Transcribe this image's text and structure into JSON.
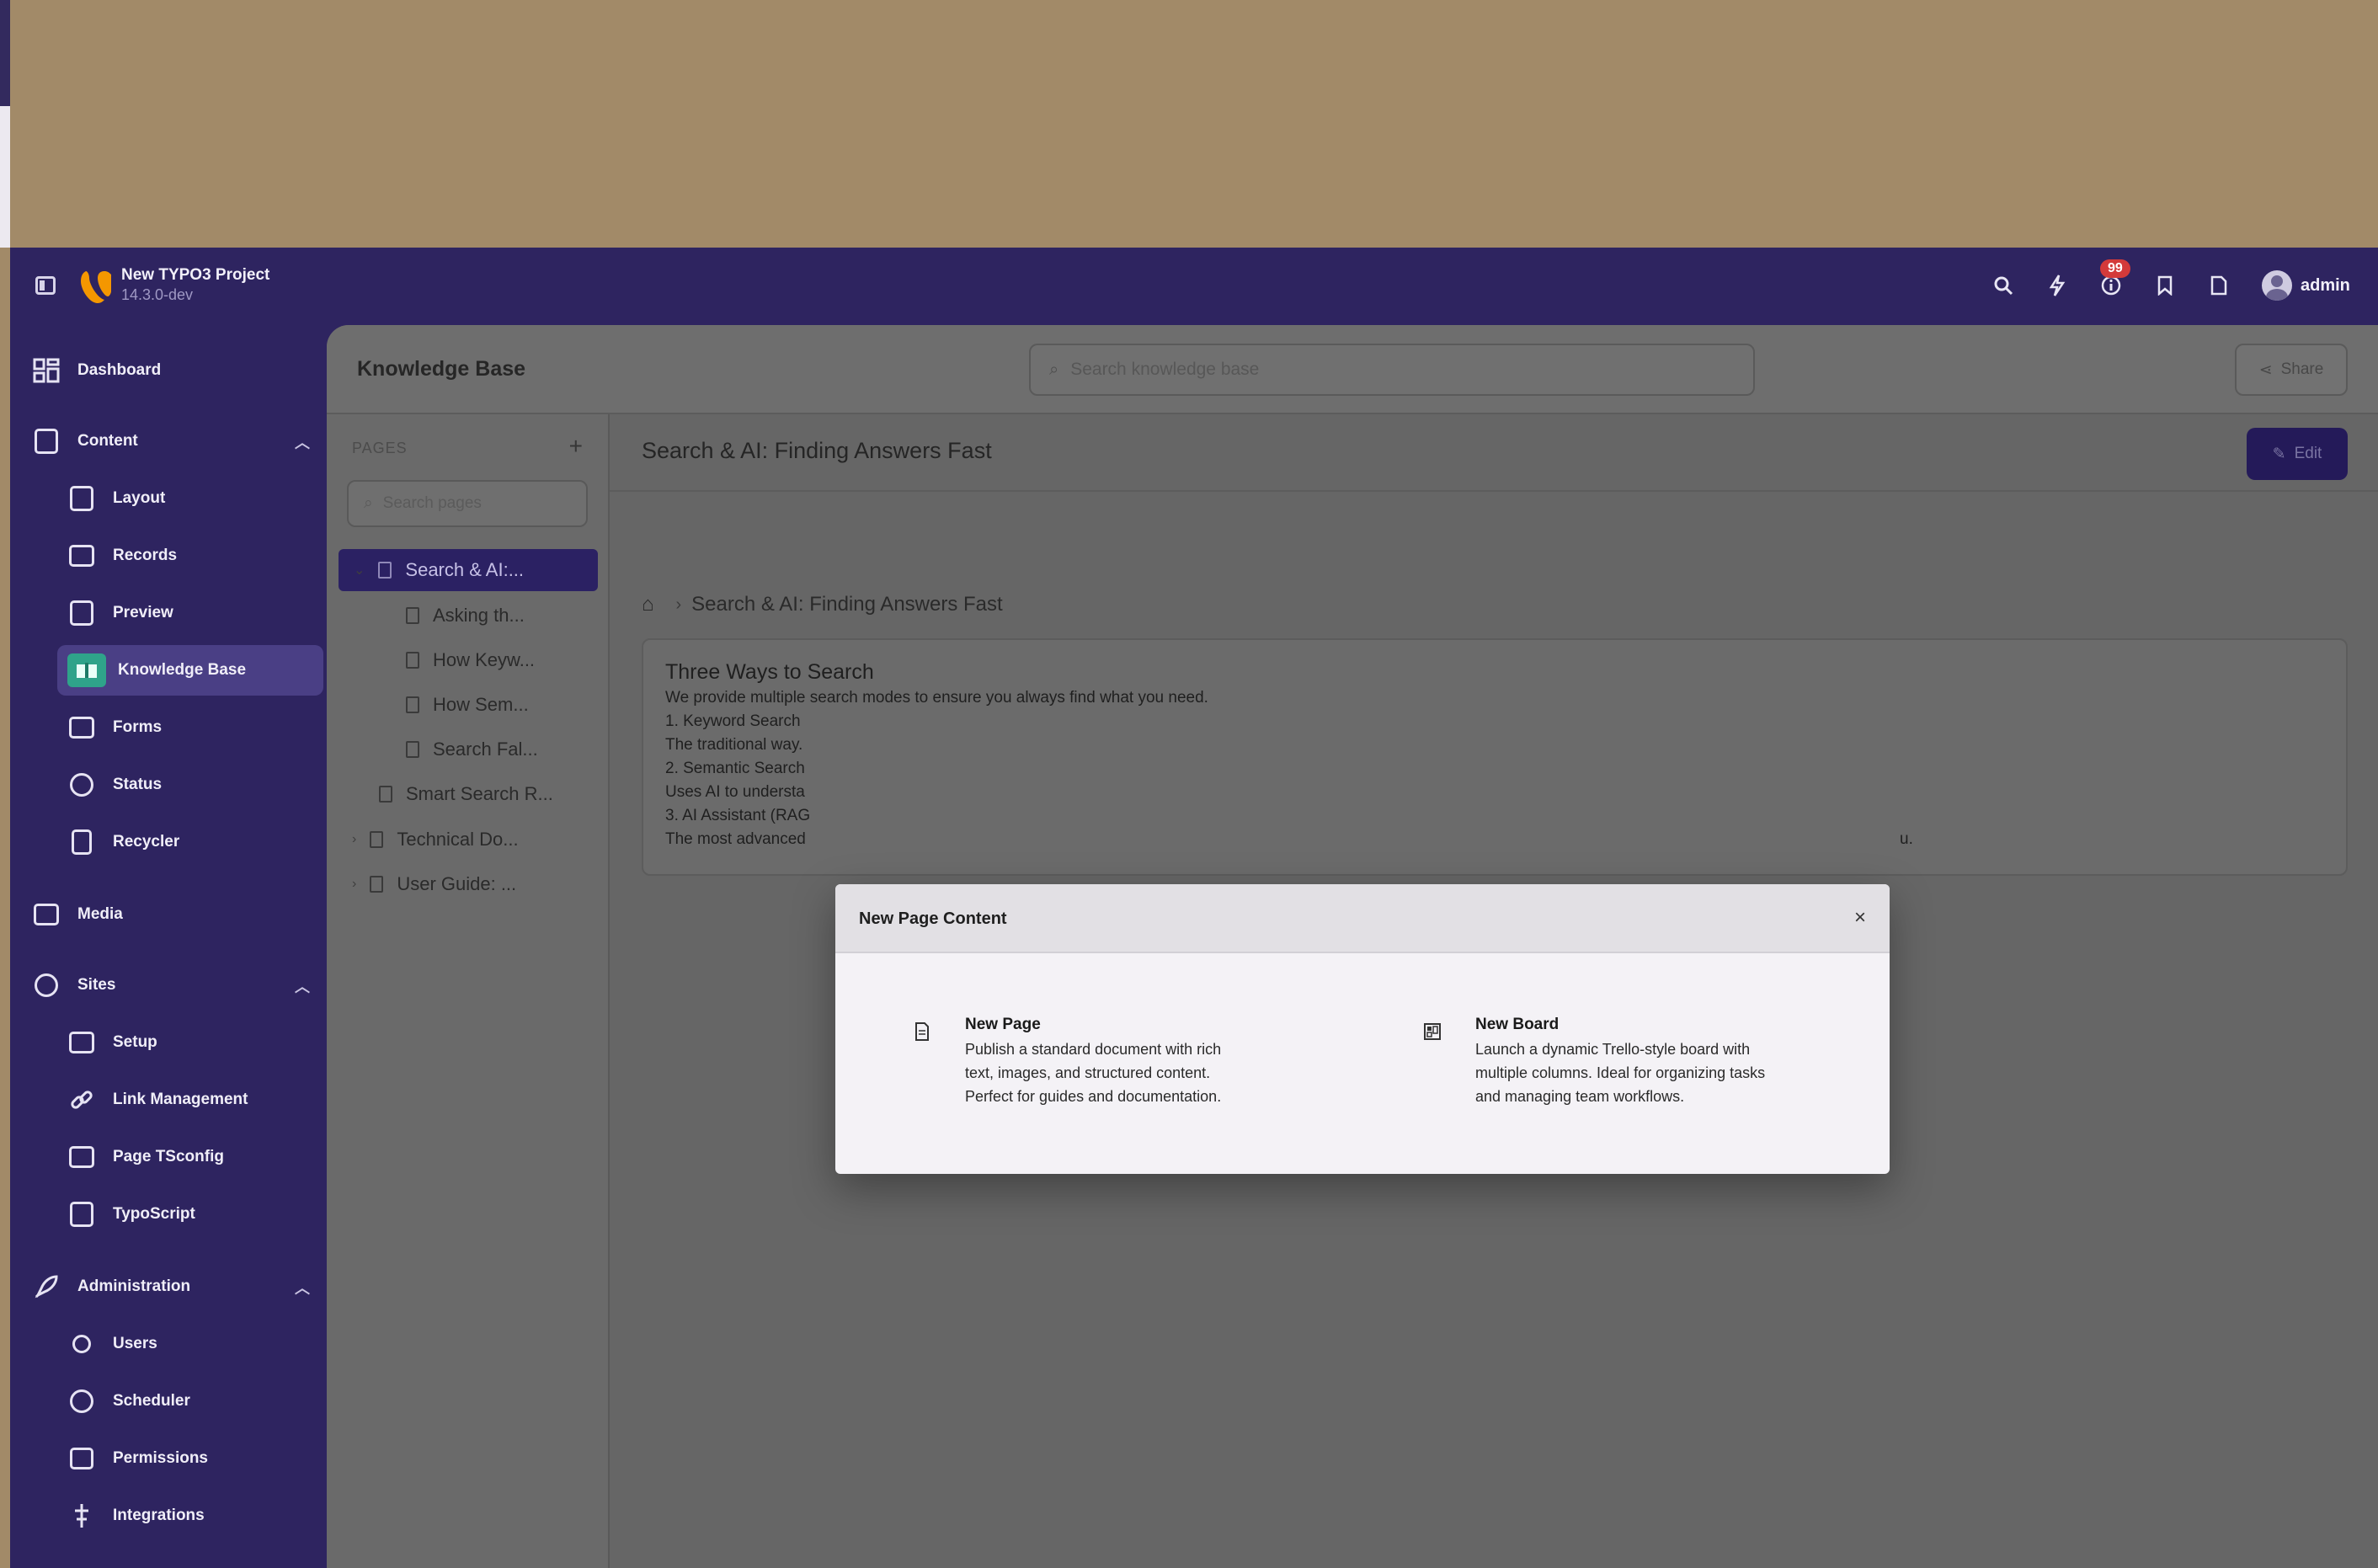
{
  "header": {
    "project_name": "New TYPO3 Project",
    "version": "14.3.0-dev",
    "notification_count": "99",
    "user": "admin"
  },
  "sidebar": {
    "dashboard": "Dashboard",
    "content": "Content",
    "content_items": [
      "Layout",
      "Records",
      "Preview",
      "Knowledge Base",
      "Forms",
      "Status",
      "Recycler"
    ],
    "media": "Media",
    "sites": "Sites",
    "sites_items": [
      "Setup",
      "Link Management",
      "Page TSconfig",
      "TypoScript"
    ],
    "administration": "Administration",
    "admin_items": [
      "Users",
      "Scheduler",
      "Permissions",
      "Integrations"
    ]
  },
  "module": {
    "title": "Knowledge Base",
    "search_placeholder": "Search knowledge base",
    "share_label": "Share"
  },
  "pages": {
    "label": "PAGES",
    "search_placeholder": "Search pages",
    "tree": [
      "Search & AI:...",
      "Asking th...",
      "How Keyw...",
      "How Sem...",
      "Search Fal...",
      "Smart Search R...",
      "Technical Do...",
      "User Guide: ..."
    ]
  },
  "content": {
    "page_title": "Search & AI: Finding Answers Fast",
    "edit_label": "Edit",
    "breadcrumb": "Search & AI: Finding Answers Fast",
    "card_heading": "Three Ways to Search",
    "card_lines": [
      "We provide multiple search modes to ensure you always find what you need.",
      "1. Keyword Search",
      "The traditional way.",
      "2. Semantic Search",
      "Uses AI to understa",
      "3. AI Assistant (RAG",
      "The most advanced"
    ],
    "card_trailing": "u."
  },
  "modal": {
    "title": "New Page Content",
    "close": "×",
    "options": [
      {
        "title": "New Page",
        "lines": [
          "Publish a standard document with rich",
          "text, images, and structured content.",
          "Perfect for guides and documentation."
        ]
      },
      {
        "title": "New Board",
        "lines": [
          "Launch a dynamic Trello-style board with",
          "multiple columns. Ideal for organizing tasks",
          "and managing team workflows."
        ]
      }
    ]
  },
  "colors": {
    "topbar": "#2e2460",
    "accent": "#2b2163",
    "badge": "#d33a3a",
    "active_icon": "#2fa38a"
  }
}
